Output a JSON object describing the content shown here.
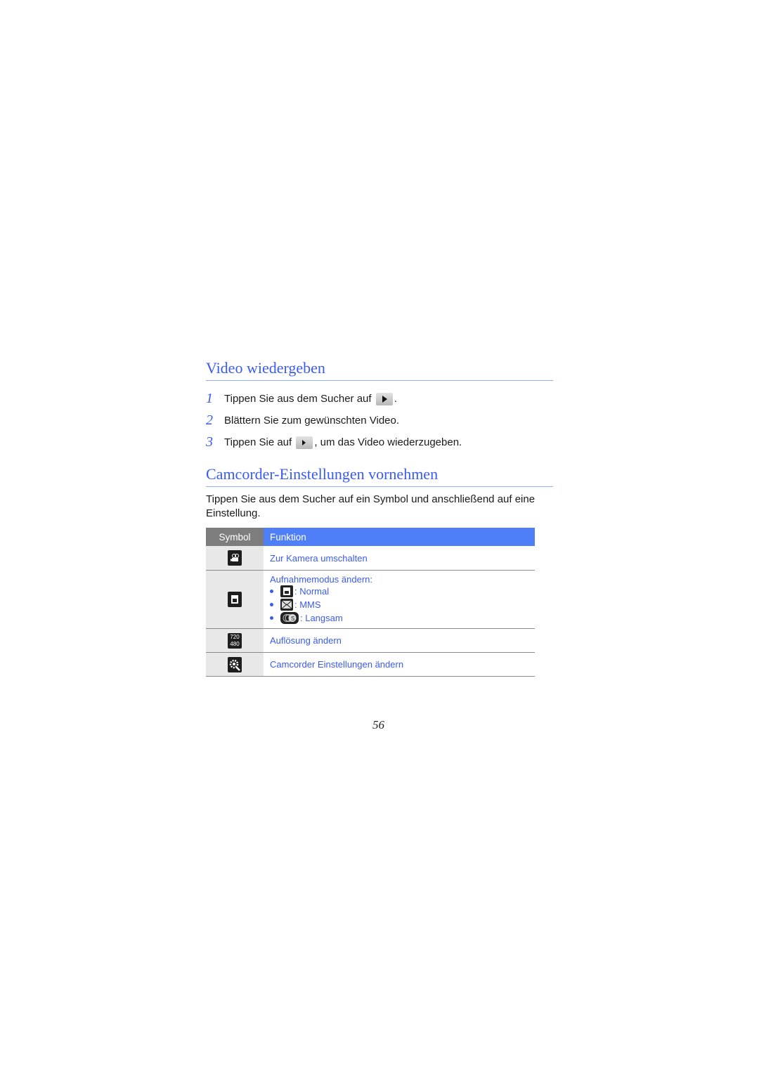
{
  "section1": {
    "title": "Video wiedergeben",
    "steps": [
      {
        "num": "1",
        "before": "Tippen Sie aus dem Sucher auf ",
        "after": ".",
        "icon": "play-icon"
      },
      {
        "num": "2",
        "text": "Blättern Sie zum gewünschten Video."
      },
      {
        "num": "3",
        "before": "Tippen Sie auf ",
        "after": ", um das Video wiederzugeben.",
        "icon": "play-icon"
      }
    ]
  },
  "section2": {
    "title": "Camcorder-Einstellungen vornehmen",
    "intro": "Tippen Sie aus dem Sucher auf ein Symbol und anschließend auf eine Einstellung.",
    "table": {
      "headers": {
        "symbol": "Symbol",
        "function": "Funktion"
      },
      "rows": [
        {
          "icon": "camera-switch-icon",
          "function": "Zur Kamera umschalten"
        },
        {
          "icon": "recording-mode-icon",
          "function": "Aufnahmemodus ändern:",
          "options": [
            {
              "icon": "normal-mode-icon",
              "label": ": Normal"
            },
            {
              "icon": "mms-mode-icon",
              "label": ": MMS"
            },
            {
              "icon": "slow-motion-icon",
              "label": ": Langsam"
            }
          ]
        },
        {
          "icon": "resolution-icon",
          "icon_text_top": "720",
          "icon_text_bottom": "480",
          "function": "Auflösung ändern"
        },
        {
          "icon": "settings-icon",
          "function": "Camcorder Einstellungen ändern"
        }
      ]
    }
  },
  "page_number": "56"
}
